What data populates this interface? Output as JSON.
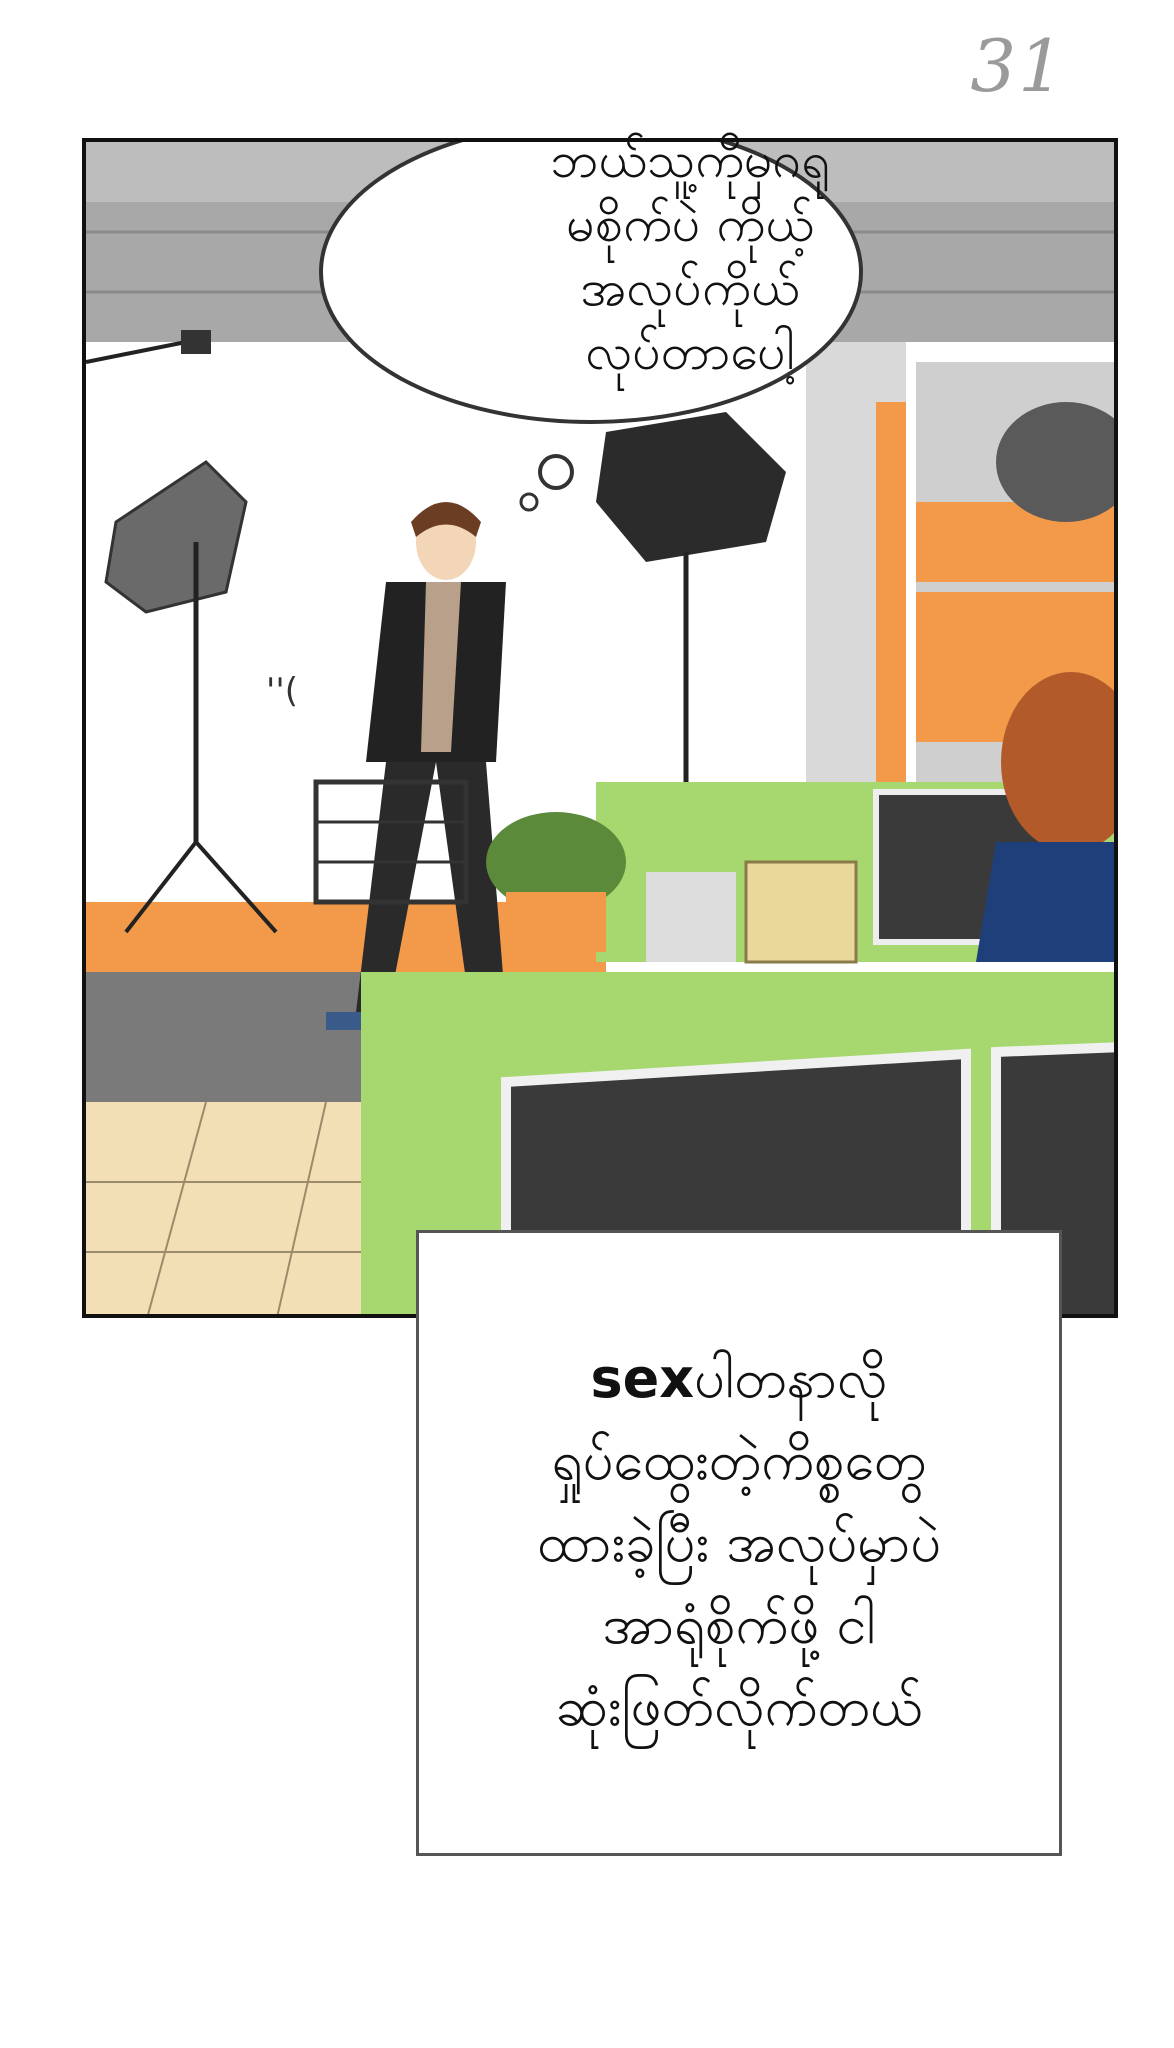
{
  "page": {
    "number": "31"
  },
  "panel": {
    "thought_bubble": {
      "lines": [
        "ဘယ်သူ့ကိုမှဂရု",
        "မစိုက်ပဲ ကိုယ့်",
        "အလုပ်ကိုယ်",
        "လုပ်တာပေါ့"
      ]
    },
    "sound_effect": "''("
  },
  "caption": {
    "lines": [
      {
        "bold": "sex",
        "text": "ပါတနာလို"
      },
      {
        "bold": "",
        "text": "ရှုပ်ထွေးတဲ့ကိစ္စတွေ"
      },
      {
        "bold": "",
        "text": "ထားခဲ့ပြီး အလုပ်မှာပဲ"
      },
      {
        "bold": "",
        "text": "အာရုံစိုက်ဖို့ ငါ"
      },
      {
        "bold": "",
        "text": "ဆုံးဖြတ်လိုက်တယ်"
      }
    ]
  },
  "colors": {
    "orange": "#f39a4a",
    "green": "#a6d86f",
    "monitor": "#3a3a3a",
    "floor": "#f3dfb6",
    "ceiling": "#9e9e9e"
  }
}
